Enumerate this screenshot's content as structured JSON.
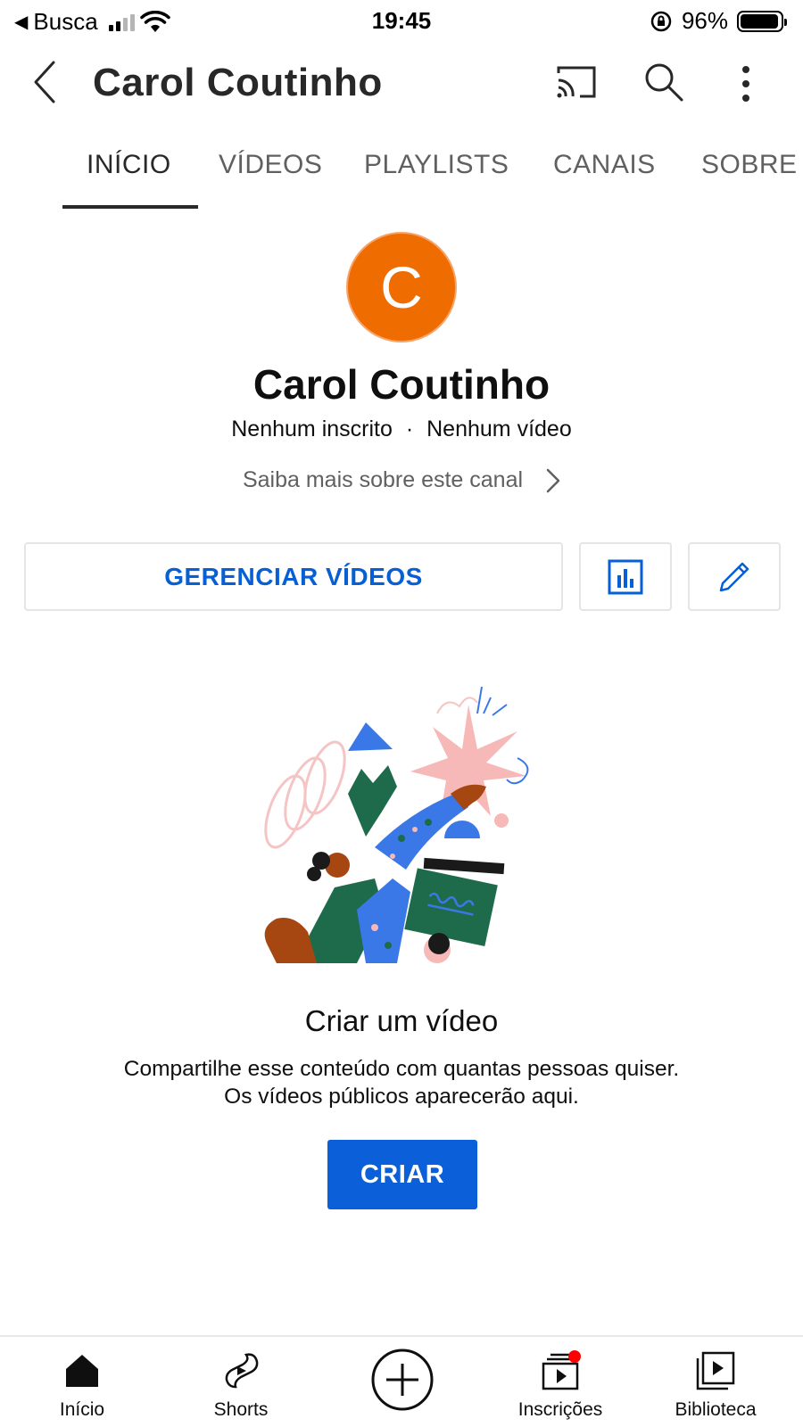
{
  "status_bar": {
    "carrier": "Busca",
    "time": "19:45",
    "battery": "96%",
    "battery_level": 0.96,
    "signal_bars_filled": 2,
    "signal_bars_total": 4
  },
  "app_bar": {
    "title": "Carol Coutinho",
    "icons": [
      "back-arrow-icon",
      "cast-icon",
      "search-icon",
      "more-vert-icon"
    ]
  },
  "tabs": [
    {
      "label": "INÍCIO",
      "active": true
    },
    {
      "label": "VÍDEOS",
      "active": false
    },
    {
      "label": "PLAYLISTS",
      "active": false
    },
    {
      "label": "CANAIS",
      "active": false
    },
    {
      "label": "SOBRE",
      "active": false
    }
  ],
  "channel": {
    "avatar_letter": "C",
    "avatar_color": "#ef6c00",
    "name": "Carol Coutinho",
    "subscribers": "Nenhum inscrito",
    "separator": "·",
    "videos": "Nenhum vídeo",
    "more_about": "Saiba mais sobre este canal"
  },
  "actions": {
    "manage_videos": "GERENCIAR VÍDEOS",
    "analytics_icon": "analytics-icon",
    "edit_icon": "pencil-icon",
    "accent_color": "#065fd4"
  },
  "empty_state": {
    "title": "Criar um vídeo",
    "description_line1": "Compartilhe esse conteúdo com quantas pessoas quiser.",
    "description_line2": "Os vídeos públicos aparecerão aqui.",
    "create_label": "CRIAR",
    "create_color": "#0b5fd9"
  },
  "bottom_nav": [
    {
      "label": "Início",
      "icon": "home-icon",
      "active": true
    },
    {
      "label": "Shorts",
      "icon": "shorts-icon",
      "active": false
    },
    {
      "label": "",
      "icon": "create-plus-icon",
      "active": false
    },
    {
      "label": "Inscrições",
      "icon": "subscriptions-icon",
      "active": false,
      "notification_dot": true
    },
    {
      "label": "Biblioteca",
      "icon": "library-icon",
      "active": false
    }
  ]
}
